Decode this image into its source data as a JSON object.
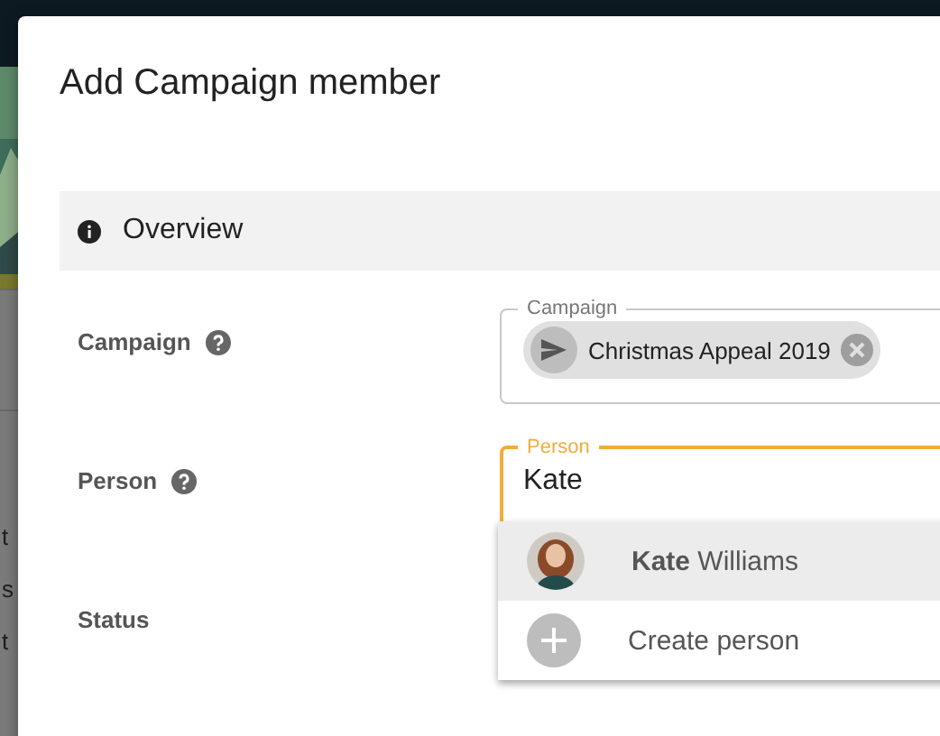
{
  "background": {
    "texts": [
      "t",
      "s",
      "t"
    ]
  },
  "dialog": {
    "title": "Add Campaign member",
    "section": {
      "title": "Overview"
    },
    "fields": [
      {
        "kind": "chips",
        "label": "Campaign",
        "help": true,
        "legend": "Campaign",
        "focused": false,
        "chips": [
          {
            "label": "Christmas Appeal 2019"
          }
        ]
      },
      {
        "kind": "text",
        "label": "Person",
        "help": true,
        "legend": "Person",
        "focused": true,
        "value": "Kate",
        "options": [
          {
            "kind": "person",
            "label": "**Kate** Williams",
            "selected": true
          },
          {
            "kind": "create",
            "label": "Create person",
            "selected": false
          }
        ]
      },
      {
        "kind": "empty",
        "label": "Status",
        "help": false
      }
    ]
  }
}
